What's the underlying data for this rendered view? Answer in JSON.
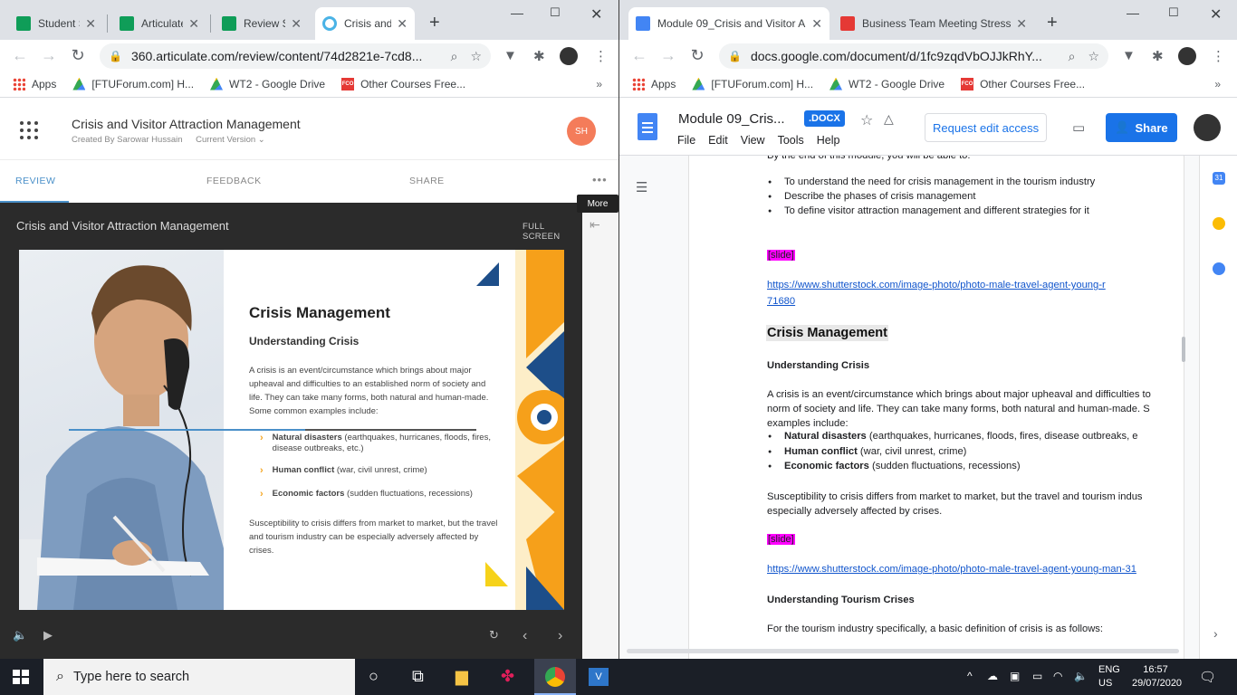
{
  "left_browser": {
    "tabs": [
      {
        "label": "Student S",
        "icon_color": "#0f9d58"
      },
      {
        "label": "Articulate",
        "icon_color": "#0f9d58"
      },
      {
        "label": "Review S",
        "icon_color": "#0f9d58"
      },
      {
        "label": "Crisis and",
        "icon_color": "#4ab3e6",
        "active": true
      }
    ],
    "url": "360.articulate.com/review/content/74d2821e-7cd8...",
    "bookmarks": [
      "Apps",
      "[FTUForum.com] H...",
      "WT2 - Google Drive",
      "Other Courses Free..."
    ],
    "bookmarks_more": "»"
  },
  "articulate": {
    "title": "Crisis and Visitor Attraction Management",
    "created_by": "Created By Sarowar Hussain",
    "version": "Current Version",
    "avatar": "SH",
    "tabs": [
      "REVIEW",
      "FEEDBACK",
      "SHARE"
    ],
    "more": "•••",
    "tooltip": "More",
    "player_title": "Crisis and Visitor Attraction Management",
    "fullscreen": "FULL SCREEN",
    "progress": 0.58
  },
  "slide": {
    "title": "Crisis Management",
    "subtitle": "Understanding Crisis",
    "intro": "A crisis is an event/circumstance which brings about major upheaval and difficulties to an established norm of society and life.  They can take many forms, both natural and human-made. Some common examples include:",
    "bullets": [
      {
        "bold": "Natural disasters",
        "rest": " (earthquakes, hurricanes, floods, fires, disease outbreaks, etc.)"
      },
      {
        "bold": "Human conflict",
        "rest": " (war, civil unrest, crime)"
      },
      {
        "bold": "Economic factors",
        "rest": " (sudden fluctuations, recessions)"
      }
    ],
    "outro": "Susceptibility to crisis differs from market to market, but the travel and tourism industry can be especially adversely affected by crises."
  },
  "right_browser": {
    "tabs": [
      {
        "label": "Module 09_Crisis and Visitor A",
        "icon_color": "#4285f4",
        "active": true
      },
      {
        "label": "Business Team Meeting Stress",
        "icon_color": "#e53935"
      }
    ],
    "url": "docs.google.com/document/d/1fc9zqdVbOJJkRhY...",
    "bookmarks": [
      "Apps",
      "[FTUForum.com] H...",
      "WT2 - Google Drive",
      "Other Courses Free..."
    ],
    "bookmarks_more": "»"
  },
  "gdoc": {
    "title": "Module 09_Cris...",
    "badge": ".DOCX",
    "menu": [
      "File",
      "Edit",
      "View",
      "Tools",
      "Help"
    ],
    "request_edit": "Request edit access",
    "share": "Share",
    "lines": {
      "top_cut": "By the end of this module, you will be able to:",
      "obj1": "To understand the need for crisis management in the tourism industry",
      "obj2": "Describe the phases of crisis management",
      "obj3": "To define visitor attraction management and different strategies for it",
      "tag": "[slide]",
      "link1a": "https://www.shutterstock.com/image-photo/photo-male-travel-agent-young-r",
      "link1b": "71680",
      "heading": "Crisis Management",
      "sub1": "Understanding Crisis",
      "p1a": "A crisis is an event/circumstance which brings about major upheaval and difficulties to",
      "p1b": "norm of society and life.  They can take many forms, both natural and human-made. S",
      "p1c": "examples include:",
      "b1bold": "Natural disasters",
      "b1rest": " (earthquakes, hurricanes, floods, fires, disease outbreaks, e",
      "b2bold": "Human conflict",
      "b2rest": " (war, civil unrest, crime)",
      "b3bold": "Economic factors",
      "b3rest": " (sudden fluctuations, recessions)",
      "p2a": "Susceptibility to crisis differs from market to market, but the travel and tourism indus",
      "p2b": "especially adversely affected by crises.",
      "link2": "https://www.shutterstock.com/image-photo/photo-male-travel-agent-young-man-31",
      "sub2": "Understanding Tourism Crises",
      "p3": "For the tourism industry specifically, a basic definition of crisis is as follows:"
    }
  },
  "taskbar": {
    "search_placeholder": "Type here to search",
    "lang1": "ENG",
    "lang2": "US",
    "time": "16:57",
    "date": "29/07/2020"
  }
}
